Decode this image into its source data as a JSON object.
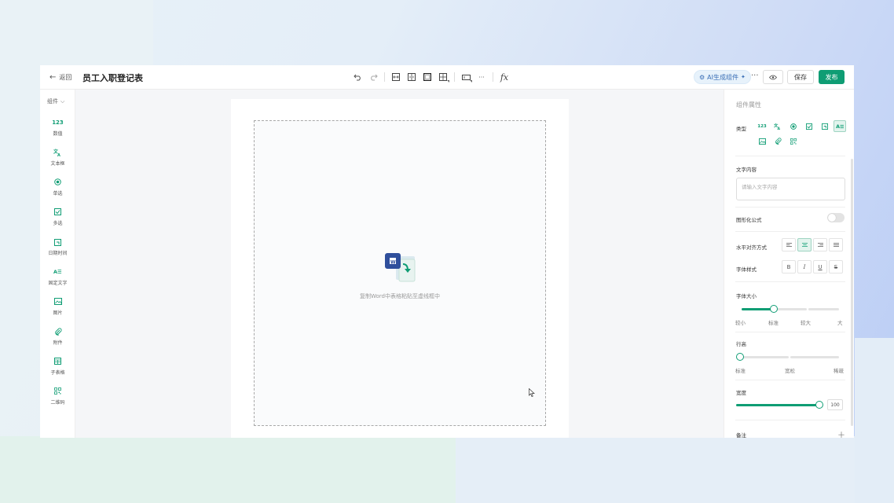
{
  "header": {
    "back_label": "返回",
    "title": "员工入职登记表",
    "ai_label": "AI生成组件",
    "more_label": "···",
    "save_label": "保存",
    "publish_label": "发布",
    "fx_label": "fx",
    "toolbar_more": "···"
  },
  "sidebar": {
    "head_label": "组件",
    "items": [
      {
        "label": "数值",
        "icon": "number-icon",
        "glyph": "123"
      },
      {
        "label": "文本框",
        "icon": "text-icon"
      },
      {
        "label": "单选",
        "icon": "radio-icon"
      },
      {
        "label": "多选",
        "icon": "checkbox-icon"
      },
      {
        "label": "日期时间",
        "icon": "date-icon"
      },
      {
        "label": "固定文字",
        "icon": "fixed-text-icon"
      },
      {
        "label": "图片",
        "icon": "image-icon"
      },
      {
        "label": "附件",
        "icon": "attachment-icon"
      },
      {
        "label": "子表格",
        "icon": "subtable-icon"
      },
      {
        "label": "二维码",
        "icon": "qrcode-icon"
      }
    ]
  },
  "canvas": {
    "drop_text": "复制Word中表格粘贴至虚线框中"
  },
  "panel": {
    "title": "组件属性",
    "type_label": "类型",
    "type_glyph_number": "123",
    "text_content_label": "文字内容",
    "text_placeholder": "请输入文字内容",
    "formula_label": "图形化公式",
    "align_label": "水平对齐方式",
    "font_style_label": "字体样式",
    "font_style_buttons": [
      "B",
      "I",
      "U",
      "S"
    ],
    "font_size_label": "字体大小",
    "font_size_ticks": [
      "较小",
      "标准",
      "较大",
      "大"
    ],
    "font_size_value": "标准",
    "line_height_label": "行高",
    "line_height_ticks": [
      "标准",
      "宽松",
      "稀疏"
    ],
    "line_height_value": "标准",
    "width_label": "宽度",
    "width_value": "100",
    "remark_label": "备注"
  },
  "colors": {
    "accent": "#0f9d74",
    "brand_blue": "#3b6fb6"
  }
}
